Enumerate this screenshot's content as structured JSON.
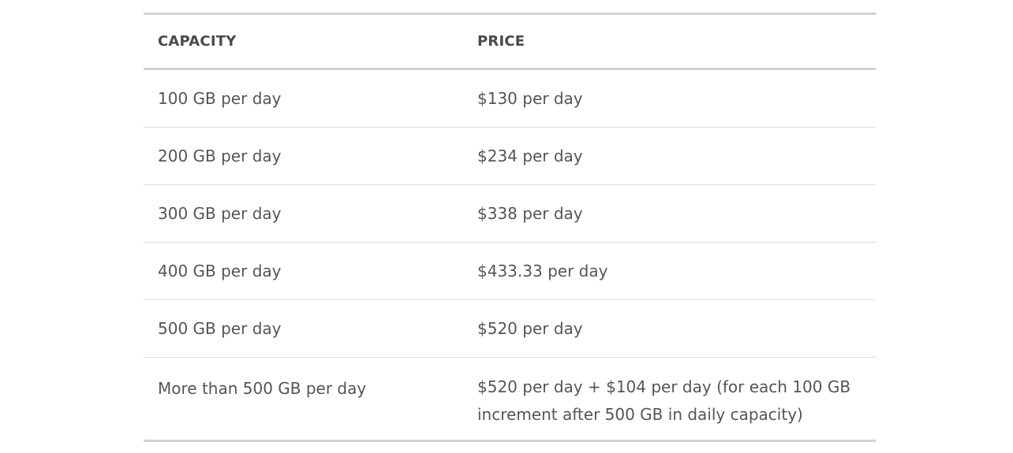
{
  "table": {
    "headers": {
      "capacity": "CAPACITY",
      "price": "PRICE"
    },
    "rows": [
      {
        "capacity": "100 GB per day",
        "price": "$130 per day"
      },
      {
        "capacity": "200 GB per day",
        "price": "$234 per day"
      },
      {
        "capacity": "300 GB per day",
        "price": "$338 per day"
      },
      {
        "capacity": "400 GB per day",
        "price": "$433.33 per day"
      },
      {
        "capacity": "500 GB per day",
        "price": "$520 per day"
      },
      {
        "capacity": "More than 500 GB per day",
        "price": "$520 per day + $104 per day (for each 100 GB increment after 500 GB in daily capacity)"
      }
    ]
  },
  "colors": {
    "border": "#d2d2d2",
    "text": "#555555",
    "header_text": "#4a4a4a"
  }
}
